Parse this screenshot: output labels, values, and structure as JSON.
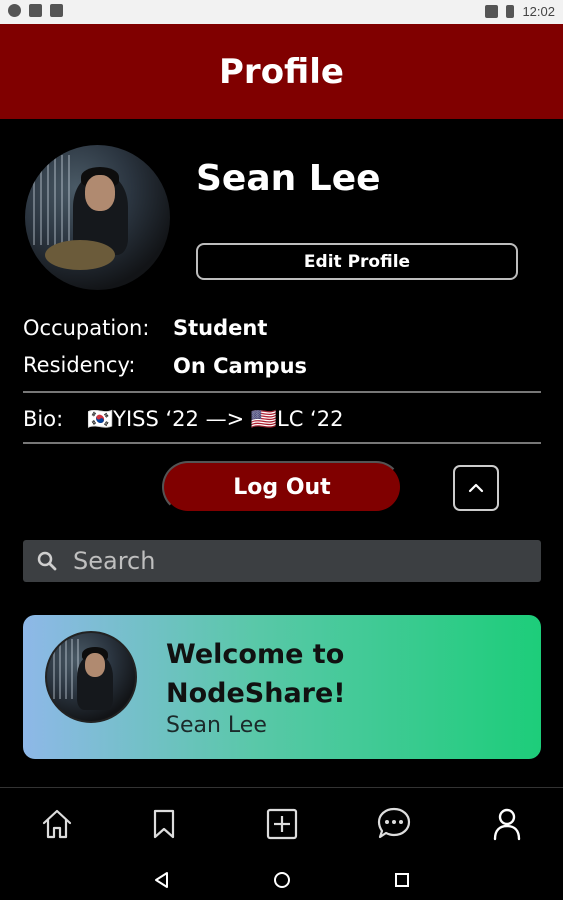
{
  "status_bar": {
    "time": "12:02",
    "icons": [
      "autofill-icon",
      "sd-card-icon",
      "android-icon",
      "lte-signal-icon",
      "battery-icon"
    ]
  },
  "header": {
    "title": "Profile"
  },
  "profile": {
    "name": "Sean Lee",
    "edit_button_label": "Edit Profile",
    "occupation_label": "Occupation:",
    "occupation_value": "Student",
    "residency_label": "Residency:",
    "residency_value": "On Campus",
    "bio_label": "Bio:",
    "bio_value": "🇰🇷YISS ‘22 —> 🇺🇸LC ‘22"
  },
  "actions": {
    "logout_label": "Log Out",
    "collapse_icon": "chevron-up-icon"
  },
  "search": {
    "placeholder": "Search"
  },
  "welcome_card": {
    "title": "Welcome to NodeShare!",
    "user_name": "Sean Lee"
  },
  "bottom_nav": {
    "items": [
      "home-icon",
      "bookmark-icon",
      "add-icon",
      "chat-icon",
      "profile-icon"
    ]
  },
  "system_nav": [
    "back-icon",
    "home-circle-icon",
    "recents-icon"
  ],
  "colors": {
    "accent": "#800000",
    "background": "#000000",
    "search_bg": "#3c3f42",
    "card_gradient_start": "#8eb8e8",
    "card_gradient_end": "#1dcd7a"
  }
}
